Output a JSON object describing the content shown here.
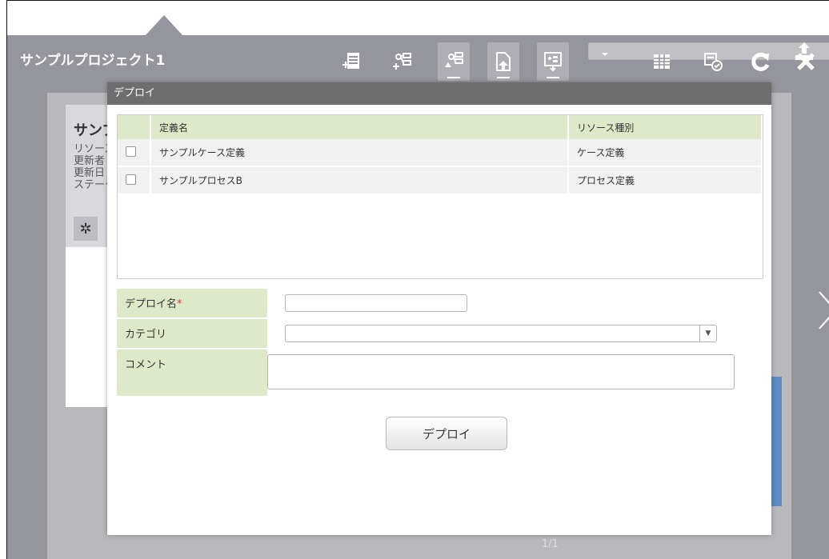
{
  "app": {
    "project_title": "サンプルプロジェクト1"
  },
  "background": {
    "card_title": "サンプ",
    "meta_lines": [
      "リソース",
      "更新者",
      "更新日",
      "ステータ"
    ],
    "page_indicator": "1/1"
  },
  "toolbar": {
    "buttons": [
      {
        "name": "add-form-icon"
      },
      {
        "name": "add-flow-icon"
      },
      {
        "name": "import-flow-icon"
      },
      {
        "name": "upload-file-icon"
      },
      {
        "name": "export-diagram-icon"
      },
      {
        "name": "deploy-icon"
      },
      {
        "name": "table-icon"
      },
      {
        "name": "release-icon"
      },
      {
        "name": "refresh-icon"
      },
      {
        "name": "close-icon"
      }
    ]
  },
  "dialog": {
    "title": "デプロイ",
    "table": {
      "headers": [
        "定義名",
        "リソース種別"
      ],
      "rows": [
        {
          "name": "サンプルケース定義",
          "type": "ケース定義"
        },
        {
          "name": "サンプルプロセスB",
          "type": "プロセス定義"
        }
      ]
    },
    "form": {
      "deploy_name_label": "デプロイ名",
      "required_mark": "*",
      "category_label": "カテゴリ",
      "comment_label": "コメント",
      "deploy_name_value": "",
      "category_value": "",
      "comment_value": ""
    },
    "deploy_button": "デプロイ"
  }
}
